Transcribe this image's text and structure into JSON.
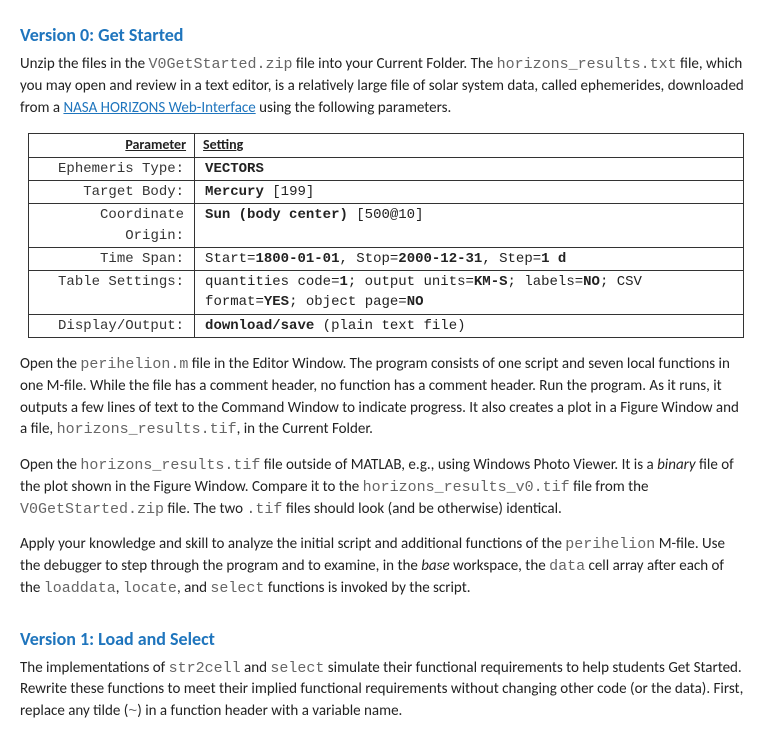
{
  "section0": {
    "title": "Version 0: Get Started",
    "p1_a": "Unzip the files in the ",
    "p1_code1": "V0GetStarted.zip",
    "p1_b": " file into your Current Folder. The ",
    "p1_code2": "horizons_results.txt",
    "p1_c": " file, which you may open and review in a text editor, is a relatively large file of solar system data, called ephemerides, downloaded from a ",
    "p1_link": "NASA HORIZONS Web-Interface",
    "p1_d": " using the following parameters."
  },
  "table": {
    "head_param": "Parameter",
    "head_setting": "Setting",
    "r1p": "Ephemeris Type:",
    "r1s": "VECTORS",
    "r2p": "Target Body:",
    "r2s_b": "Mercury",
    "r2s_n": " [199]",
    "r3p": "Coordinate Origin:",
    "r3s_b": "Sun (body center)",
    "r3s_n": " [500@10]",
    "r4p": "Time Span:",
    "r4s_a": "Start=",
    "r4s_b1": "1800-01-01",
    "r4s_c": ", Stop=",
    "r4s_b2": "2000-12-31",
    "r4s_d": ", Step=",
    "r4s_b3": "1 d",
    "r5p": "Table Settings:",
    "r5s_a": "quantities code=",
    "r5s_b1": "1",
    "r5s_c": "; output units=",
    "r5s_b2": "KM-S",
    "r5s_d": "; labels=",
    "r5s_b3": "NO",
    "r5s_e": "; CSV format=",
    "r5s_b4": "YES",
    "r5s_f": "; object page=",
    "r5s_b5": "NO",
    "r6p": "Display/Output:",
    "r6s_b": "download/save",
    "r6s_n": " (plain text file)"
  },
  "p2": {
    "a": "Open the ",
    "code1": "perihelion.m",
    "b": " file in the Editor Window. The program consists of one script and seven local functions in one M-file. While the file has a comment header, no function has a comment header. Run the program. As it runs, it outputs a few lines of text to the Command Window to indicate progress. It also creates a plot in a Figure Window and a file, ",
    "code2": "horizons_results.tif",
    "c": ", in the Current Folder."
  },
  "p3": {
    "a": "Open the ",
    "code1": "horizons_results.tif",
    "b": " file outside of MATLAB, e.g., using Windows Photo Viewer. It is a ",
    "ital": "binary",
    "c": " file of the plot shown in the Figure Window. Compare it to the ",
    "code2": "horizons_results_v0.tif",
    "d": " file from the ",
    "code3": "V0GetStarted.zip",
    "e": " file. The two ",
    "code4": ".tif",
    "f": " files should look (and be otherwise) identical."
  },
  "p4": {
    "a": "Apply your knowledge and skill to analyze the initial script and additional functions of the ",
    "code1": "perihelion",
    "b": " M-file. Use the debugger to step through the program and to examine, in the ",
    "ital": "base",
    "c": " workspace, the ",
    "code2": "data",
    "d": " cell array after each of the ",
    "code3": "loaddata",
    "e": ", ",
    "code4": "locate",
    "f": ", and ",
    "code5": "select",
    "g": " functions is invoked by the script."
  },
  "section1": {
    "title": "Version 1: Load and Select",
    "a": "The implementations of ",
    "code1": "str2cell",
    "b": " and ",
    "code2": "select",
    "c": " simulate their functional requirements to help students Get Started. Rewrite these functions to meet their implied functional requirements without changing other code (or the data). First, replace any tilde (",
    "code3": "~",
    "d": ") in a function header with a variable name."
  }
}
